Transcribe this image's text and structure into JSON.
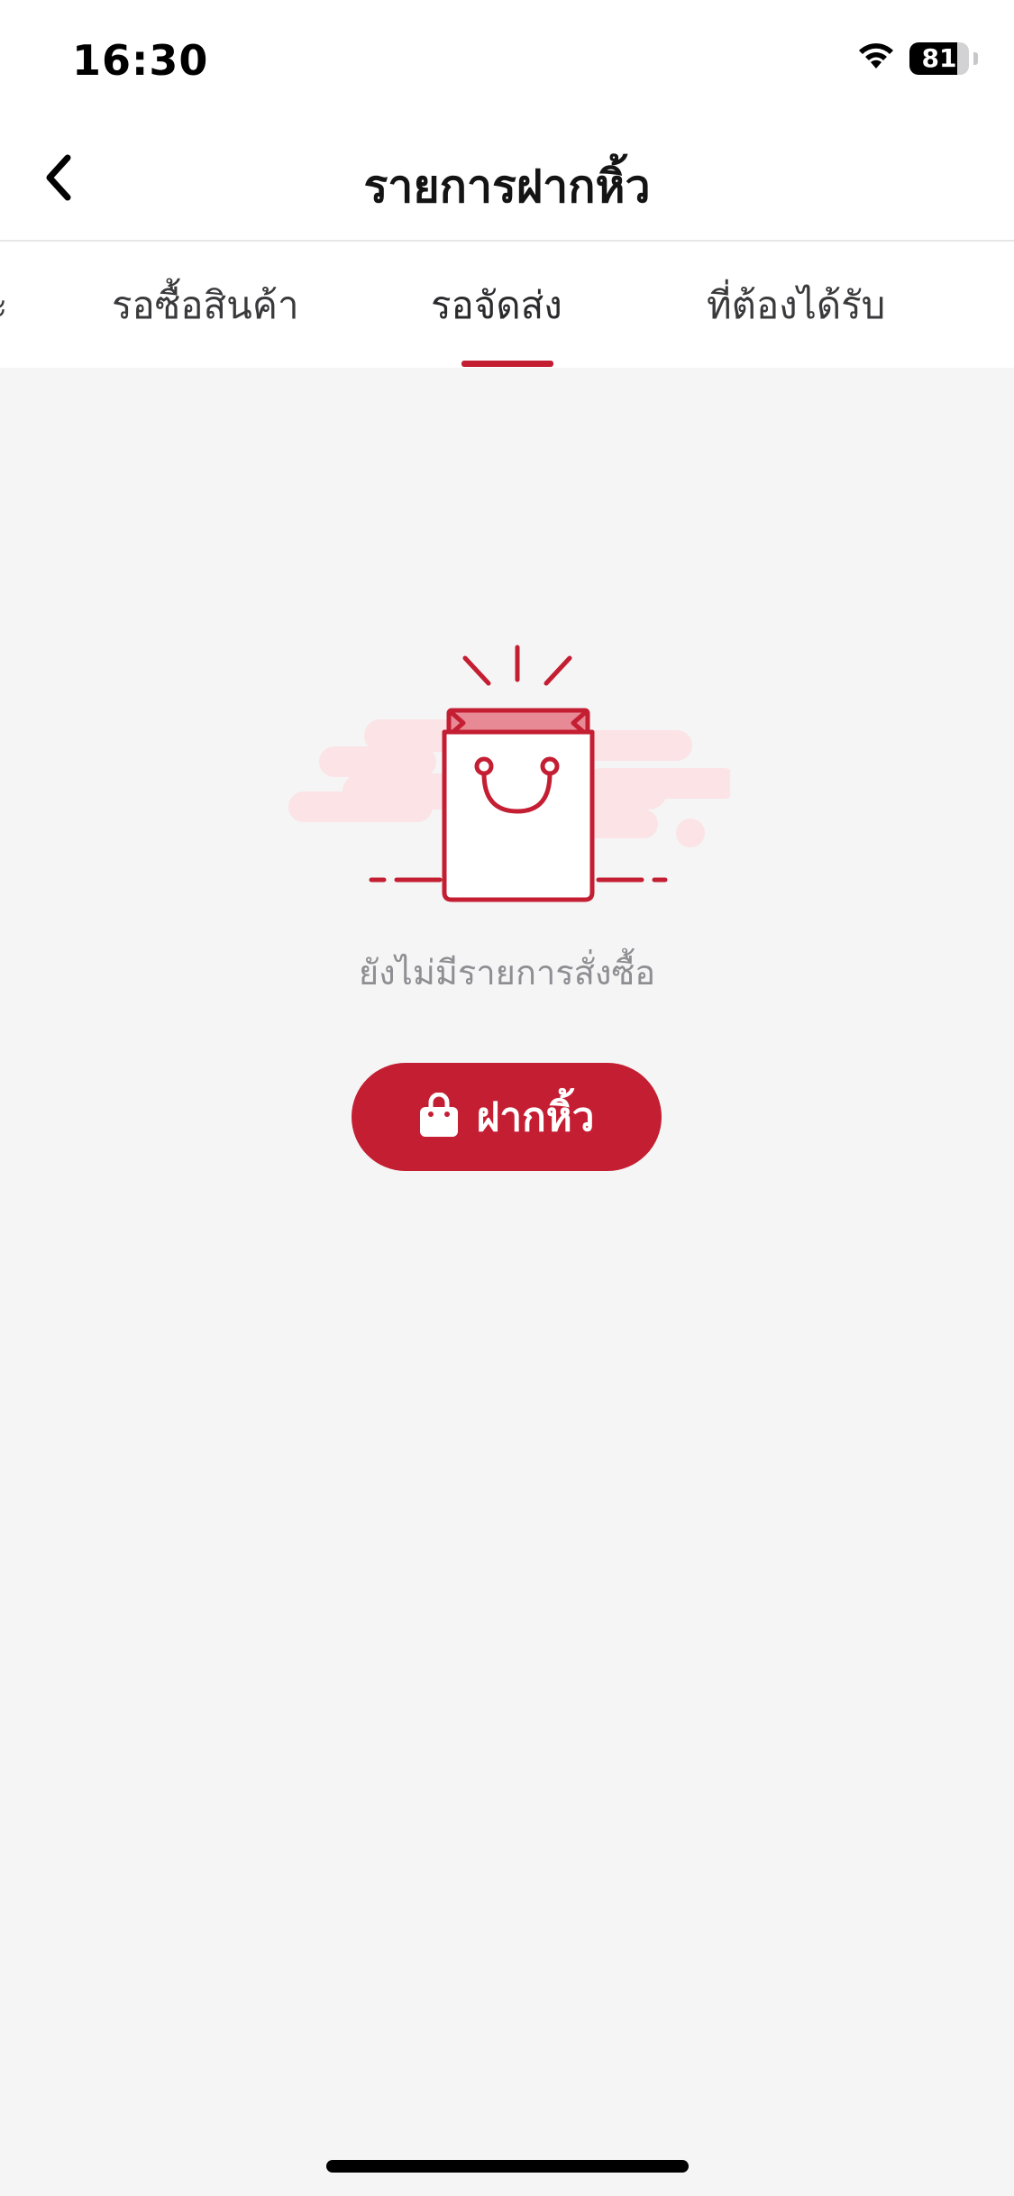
{
  "status_bar": {
    "time": "16:30",
    "battery_level": "81",
    "battery_fraction": 0.81,
    "wifi_icon": "wifi-icon"
  },
  "header": {
    "title": "รายการฝากหิ้ว",
    "back_icon": "chevron-left-icon"
  },
  "tabs": {
    "items": [
      {
        "label": "ะ"
      },
      {
        "label": "รอซื้อสินค้า"
      },
      {
        "label": "รอจัดส่ง"
      },
      {
        "label": "ที่ต้องได้รับ"
      }
    ],
    "active_index": 2
  },
  "empty_state": {
    "illustration_icon": "shopping-bag-icon",
    "message": "ยังไม่มีรายการสั่งซื้อ",
    "button": {
      "label": "ฝากหิ้ว",
      "icon": "bag-icon"
    }
  },
  "colors": {
    "accent": "#c41e33",
    "background": "#f5f5f5",
    "illustration_light": "#fbe3e6"
  }
}
